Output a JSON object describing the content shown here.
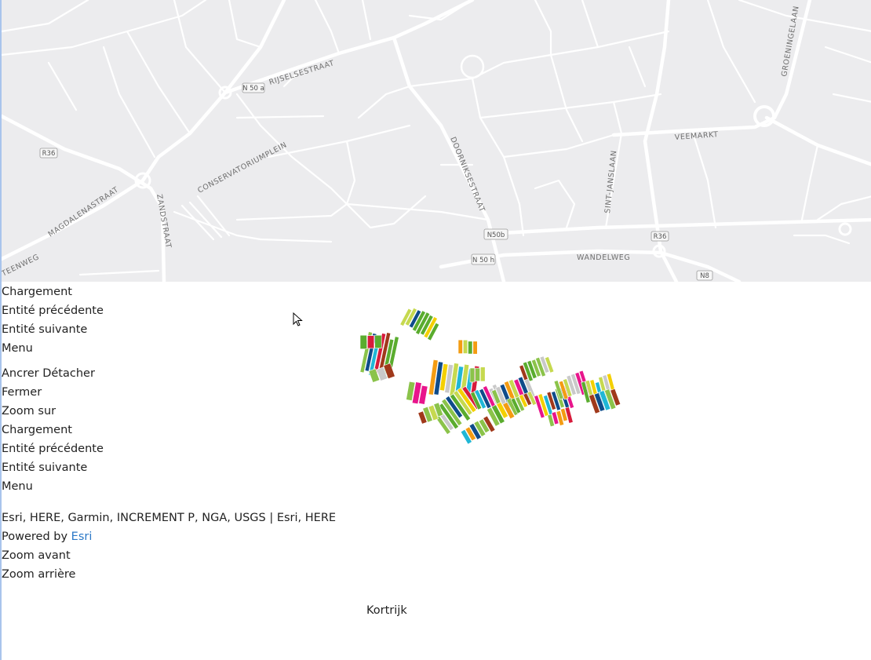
{
  "map": {
    "road_labels": {
      "rijselsestraat": "RIJSELSESTRAAT",
      "doorniksestraat": "DOORNIKSESTRAAT",
      "magdalenastraat": "MAGDALENASTRAAT",
      "zandstraat": "ZANDSTRAAT",
      "conservatoriumplein": "CONSERVATORIUMPLEIN",
      "sint_janslaan": "SINT-JANSLAAN",
      "veemarkt": "VEEMARKT",
      "wandelweg": "WANDELWEG",
      "groeningelaan": "GROENINGELAAN",
      "steenweg": "TEENWEG"
    },
    "shields": {
      "n50a": "N 50 a",
      "r36_left": "R36",
      "n50b": "N50b",
      "r36_right": "R36",
      "n50h": "N 50 h",
      "n8": "N8"
    }
  },
  "popup_top": {
    "loading": "Chargement",
    "previous": "Entité précédente",
    "next": "Entité suivante",
    "menu": "Menu"
  },
  "popup_actions": {
    "dock_undock": "Ancrer Détacher",
    "close": "Fermer",
    "zoom_to": "Zoom sur",
    "loading": "Chargement",
    "previous": "Entité précédente",
    "next": "Entité suivante",
    "menu": "Menu"
  },
  "attribution": {
    "sources": "Esri, HERE, Garmin, INCREMENT P, NGA, USGS | Esri, HERE",
    "powered_by": "Powered by",
    "esri_link": "Esri"
  },
  "zoom": {
    "zoom_in": "Zoom avant",
    "zoom_out": "Zoom arrière"
  },
  "popup_title": "Kortrijk",
  "colors": {
    "basemap_bg": "#ececee",
    "road": "#ffffff",
    "link": "#2b78c7",
    "parcel_palette": [
      "#8bc34a",
      "#5aac2e",
      "#c6d94f",
      "#f4d000",
      "#e8158c",
      "#a0391b",
      "#0f4c8a",
      "#20b7d6",
      "#c9c9c9",
      "#d71b3b",
      "#f39c12"
    ]
  }
}
